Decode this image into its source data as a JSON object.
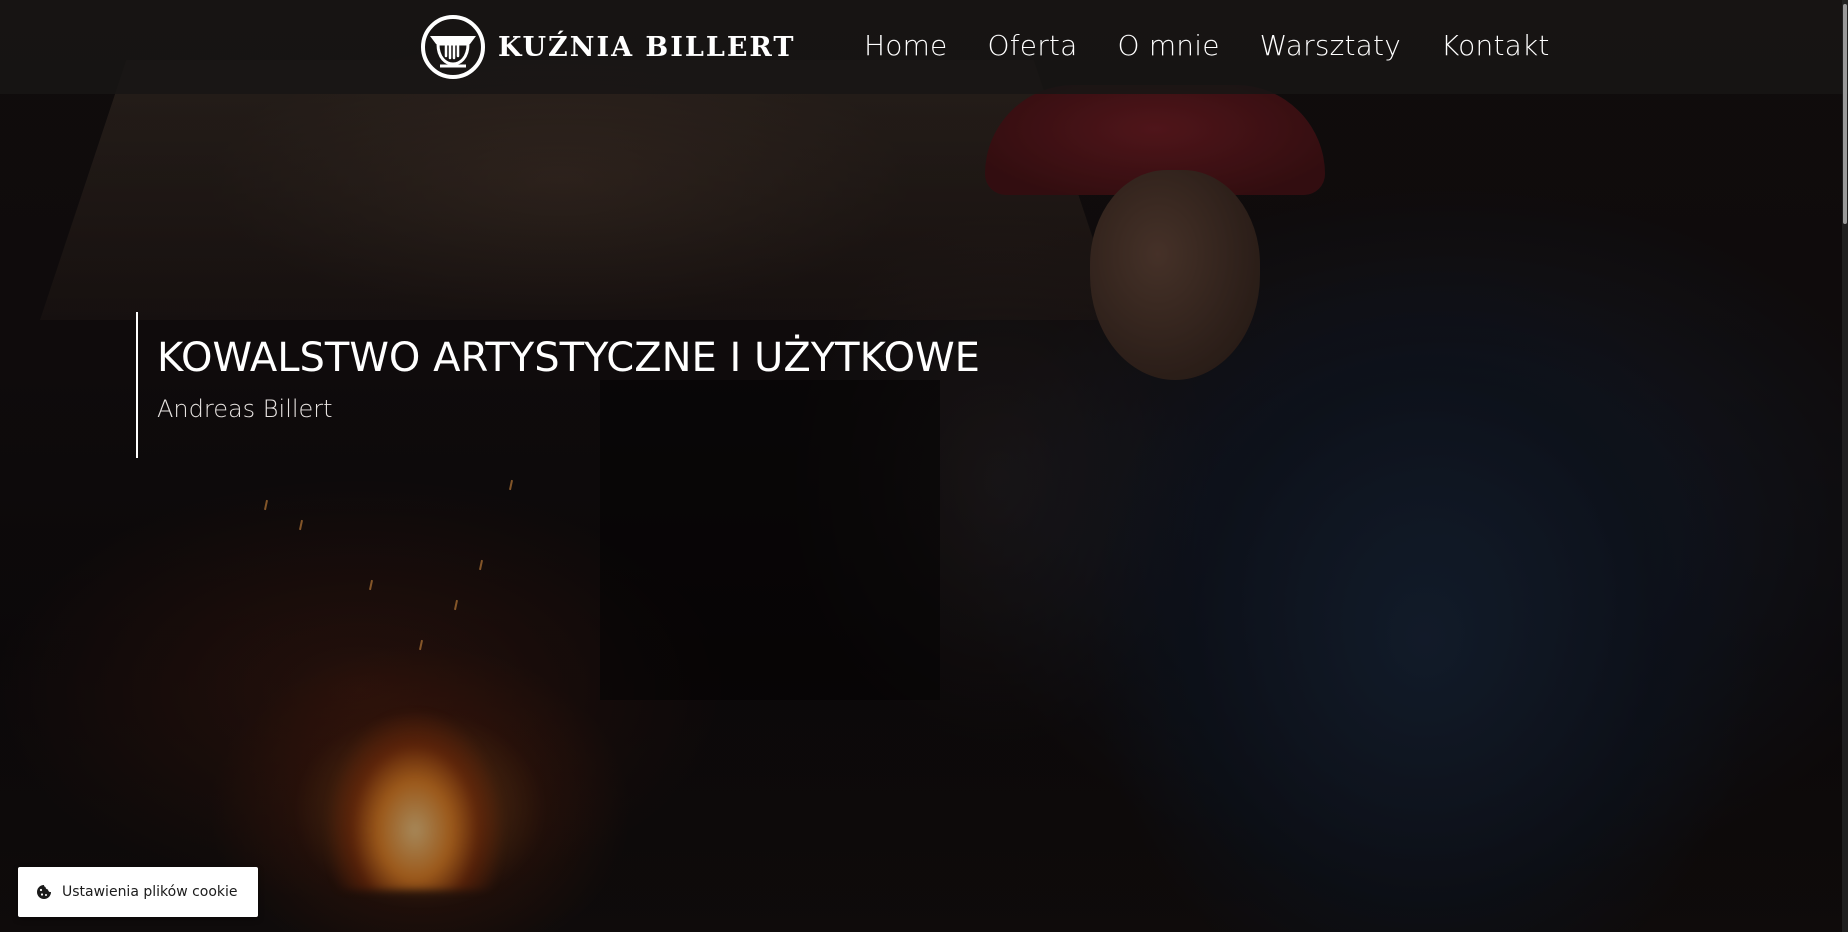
{
  "header": {
    "logo_text": "KUŹNIA BILLERT",
    "logo_icon": "anvil-hand-emblem-icon",
    "nav": [
      {
        "label": "Home"
      },
      {
        "label": "Oferta"
      },
      {
        "label": "O mnie"
      },
      {
        "label": "Warsztaty"
      },
      {
        "label": "Kontakt"
      }
    ]
  },
  "hero": {
    "title": "KOWALSTWO ARTYSTYCZNE I UŻYTKOWE",
    "subtitle": "Andreas Billert",
    "background": "blacksmith-at-forge-photo"
  },
  "cookie": {
    "label": "Ustawienia plików cookie",
    "icon": "cookie-icon"
  },
  "colors": {
    "header_bg": "#181615",
    "text": "#ffffff",
    "cookie_bg": "#ffffff",
    "cookie_text": "#1b1b1b"
  }
}
